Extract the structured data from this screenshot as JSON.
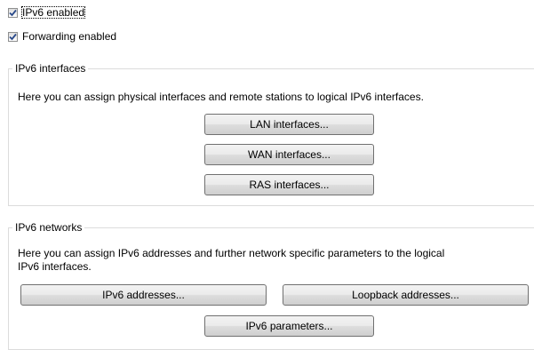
{
  "options": {
    "ipv6_enabled": {
      "label": "IPv6 enabled",
      "checked": true
    },
    "forwarding_enabled": {
      "label": "Forwarding enabled",
      "checked": true
    }
  },
  "ipv6_interfaces": {
    "title": "IPv6 interfaces",
    "description": "Here you can assign physical interfaces and remote stations to logical IPv6 interfaces.",
    "buttons": {
      "lan": "LAN interfaces...",
      "wan": "WAN interfaces...",
      "ras": "RAS interfaces..."
    }
  },
  "ipv6_networks": {
    "title": "IPv6 networks",
    "description_line1": "Here you can assign IPv6 addresses and further network specific parameters to the logical",
    "description_line2": "IPv6 interfaces.",
    "buttons": {
      "addresses": "IPv6 addresses...",
      "loopback": "Loopback addresses...",
      "parameters": "IPv6 parameters..."
    }
  },
  "colors": {
    "check_mark": "#2a4a8a",
    "group_border": "#dcdcdc",
    "button_border": "#707070"
  },
  "icons": {
    "checkbox_checked": "check-icon"
  }
}
